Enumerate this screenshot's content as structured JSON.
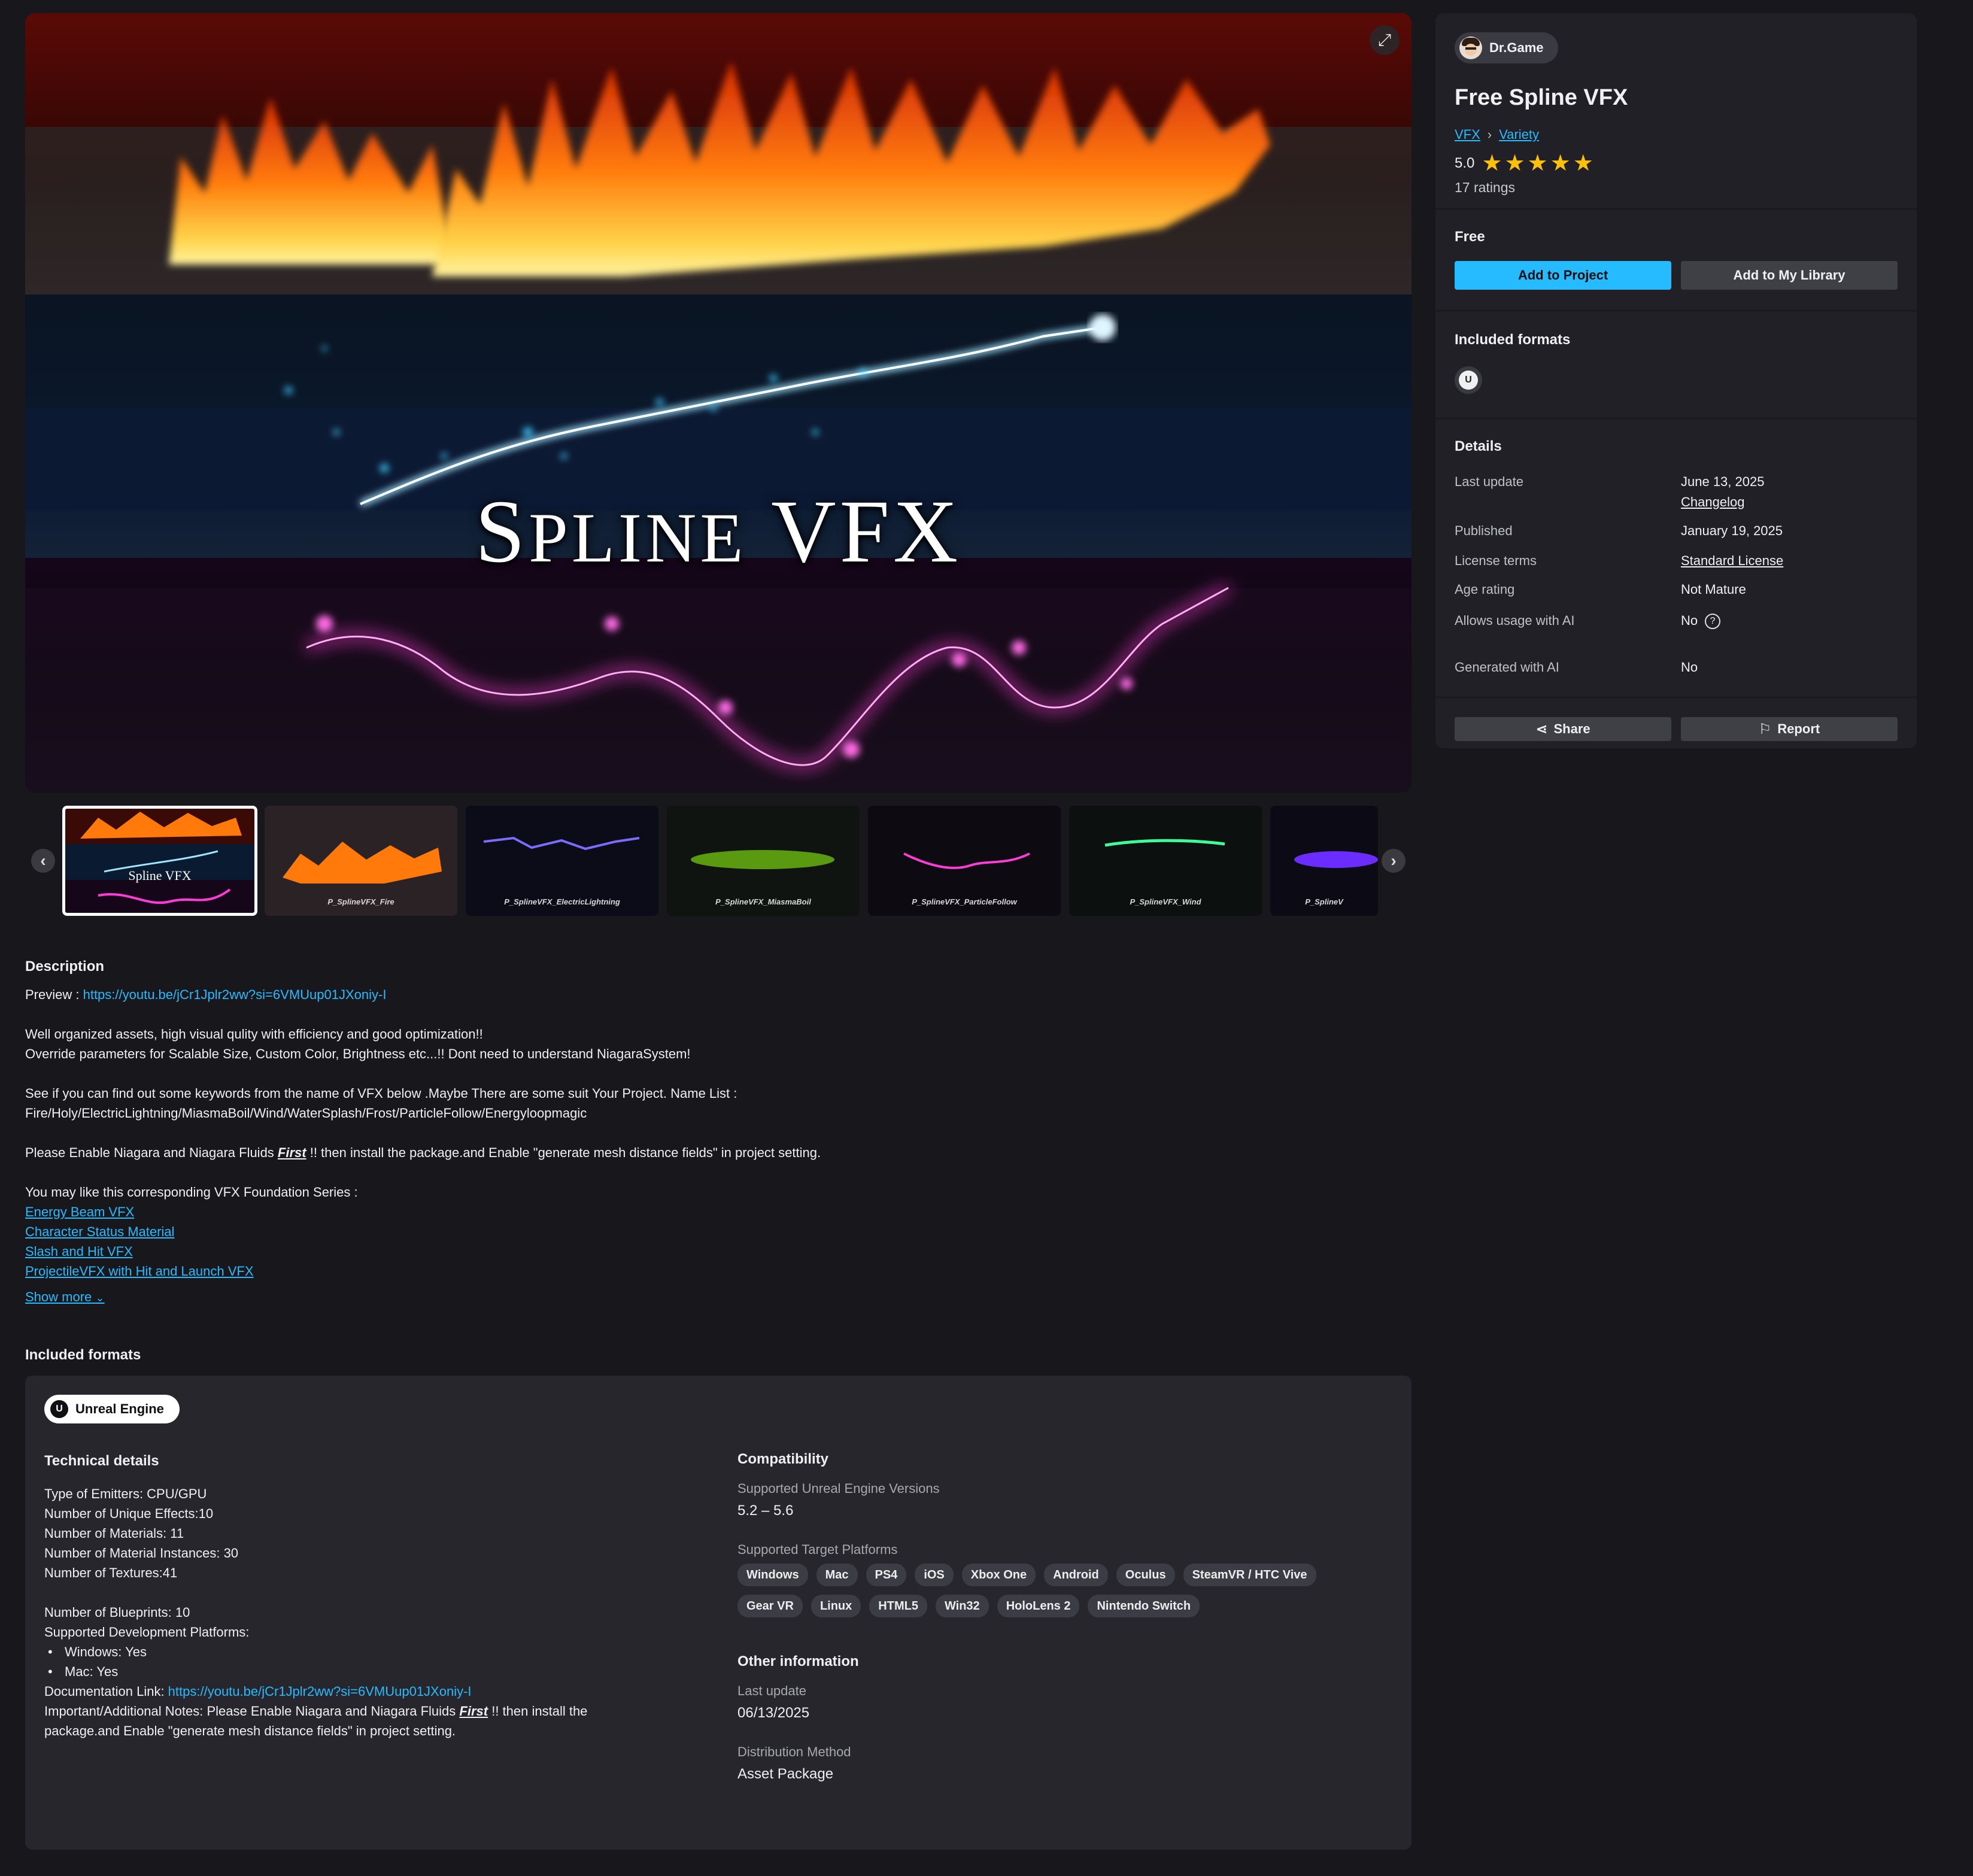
{
  "hero": {
    "title": "Spline VFX",
    "title_first": "S",
    "title_rest_1": "PLINE",
    "title_v": "VFX"
  },
  "thumbnails": [
    {
      "label": "",
      "caption": "Spline VFX"
    },
    {
      "label": "P_SplineVFX_Fire"
    },
    {
      "label": "P_SplineVFX_ElectricLightning"
    },
    {
      "label": "P_SplineVFX_MiasmaBoil"
    },
    {
      "label": "P_SplineVFX_ParticleFollow"
    },
    {
      "label": "P_SplineVFX_Wind"
    },
    {
      "label": "P_SplineV"
    }
  ],
  "description": {
    "heading": "Description",
    "preview_label": "Preview : ",
    "preview_link": "https://youtu.be/jCr1Jplr2ww?si=6VMUup01JXoniy-I",
    "para1_line1": "Well organized assets, high visual qulity with efficiency and good optimization!!",
    "para1_line2": "Override parameters for Scalable Size, Custom Color, Brightness etc...!! Dont need to understand NiagaraSystem!",
    "para2_line1": "See if you can find out some keywords from the name of VFX below .Maybe There are some suit Your Project. Name List :",
    "para2_line2": "Fire/Holy/ElectricLightning/MiasmaBoil/Wind/WaterSplash/Frost/ParticleFollow/Energyloopmagic",
    "para3_pre": "Please Enable Niagara and Niagara Fluids ",
    "para3_em": "First",
    "para3_post": " !! then install the package.and  Enable \"generate mesh distance fields\" in project setting.",
    "para4": "You may like this corresponding VFX Foundation Series :",
    "links": [
      "Energy Beam VFX",
      "Character Status Material",
      "Slash and Hit VFX",
      "ProjectileVFX with Hit and Launch VFX"
    ],
    "show_more": "Show more"
  },
  "included_formats_title": "Included formats",
  "formats_panel": {
    "engine_pill": "Unreal Engine",
    "ue_glyph": "U",
    "technical": {
      "heading": "Technical details",
      "lines1": [
        "Type of Emitters: CPU/GPU",
        "Number of Unique Effects:10",
        "Number of Materials: 11",
        "Number of Material Instances: 30",
        "Number of Textures:41"
      ],
      "lines2": [
        "Number of Blueprints: 10",
        "Supported Development Platforms:"
      ],
      "bullets": [
        "Windows: Yes",
        "Mac: Yes"
      ],
      "doc_label": "Documentation Link: ",
      "doc_link": "https://youtu.be/jCr1Jplr2ww?si=6VMUup01JXoniy-I",
      "notes_pre": "Important/Additional Notes: Please Enable Niagara and Niagara Fluids ",
      "notes_em": "First",
      "notes_post": " !! then install the",
      "notes_line2": "package.and  Enable \"generate mesh distance fields\" in project setting."
    },
    "compatibility": {
      "heading": "Compatibility",
      "versions_label": "Supported Unreal Engine Versions",
      "versions_value": "5.2 – 5.6",
      "platforms_label": "Supported Target Platforms",
      "platforms": [
        "Windows",
        "Mac",
        "PS4",
        "iOS",
        "Xbox One",
        "Android",
        "Oculus",
        "SteamVR / HTC Vive",
        "Gear VR",
        "Linux",
        "HTML5",
        "Win32",
        "HoloLens 2",
        "Nintendo Switch"
      ]
    },
    "other": {
      "heading": "Other information",
      "last_update_label": "Last update",
      "last_update_value": "06/13/2025",
      "distribution_label": "Distribution Method",
      "distribution_value": "Asset Package"
    }
  },
  "sidebar": {
    "author": "Dr.Game",
    "title": "Free Spline VFX",
    "crumb1": "VFX",
    "crumb2": "Variety",
    "rating_value": "5.0",
    "rating_stars": 5,
    "ratings_count": "17 ratings",
    "price": "Free",
    "add_to_project": "Add to Project",
    "add_to_library": "Add to My Library",
    "formats_label": "Included formats",
    "details_label": "Details",
    "details": {
      "last_update_k": "Last update",
      "last_update_v": "June 13, 2025",
      "changelog": "Changelog",
      "published_k": "Published",
      "published_v": "January 19, 2025",
      "license_k": "License terms",
      "license_v": "Standard License",
      "age_k": "Age rating",
      "age_v": "Not Mature",
      "ai_usage_k": "Allows usage with AI",
      "ai_usage_v": "No",
      "ai_gen_k": "Generated with AI",
      "ai_gen_v": "No"
    },
    "share": "Share",
    "report": "Report"
  },
  "colors": {
    "accent": "#26bbff",
    "star": "#ffc107",
    "background": "#18181c",
    "panel": "#26262c"
  }
}
